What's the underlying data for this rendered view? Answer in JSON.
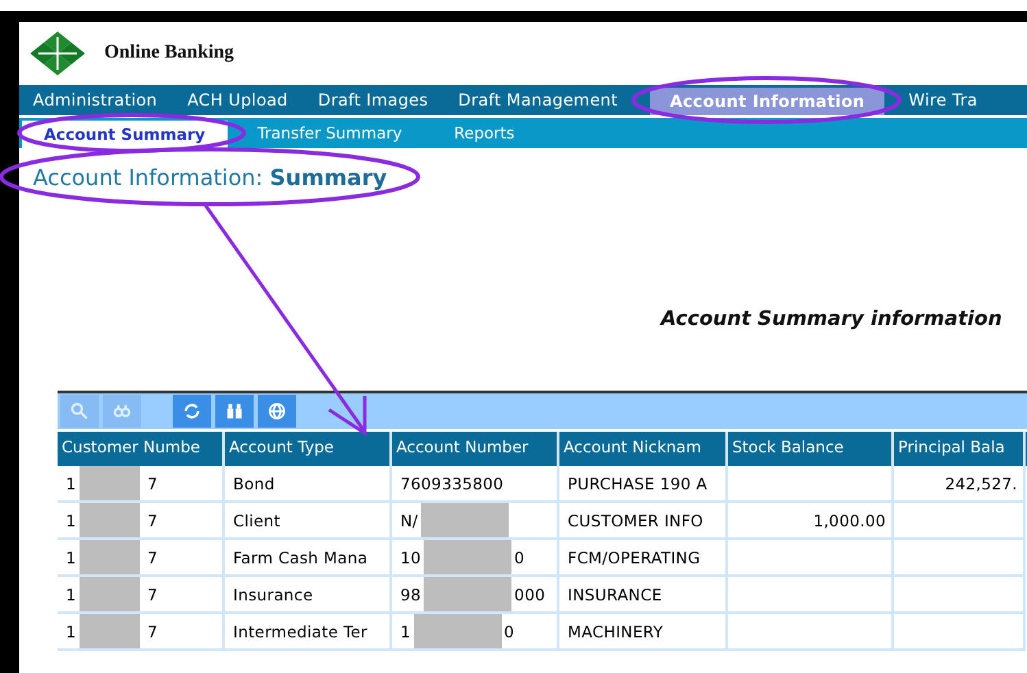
{
  "logo": {
    "title": "Online Banking"
  },
  "nav": [
    {
      "label": "Administration",
      "selected": false
    },
    {
      "label": "ACH Upload",
      "selected": false
    },
    {
      "label": "Draft Images",
      "selected": false
    },
    {
      "label": "Draft Management",
      "selected": false
    },
    {
      "label": "Account Information",
      "selected": true
    },
    {
      "label": "Wire Tra",
      "selected": false
    }
  ],
  "subnav": [
    {
      "label": "Account Summary",
      "selected": true
    },
    {
      "label": "Transfer Summary",
      "selected": false
    },
    {
      "label": "Reports",
      "selected": false
    }
  ],
  "heading": {
    "prefix": "Account Information:",
    "emphasis": "Summary"
  },
  "section_title": "Account Summary information",
  "toolbar": [
    {
      "kind": "search",
      "disabled": true
    },
    {
      "kind": "find",
      "disabled": true
    },
    {
      "kind": "refresh",
      "disabled": false
    },
    {
      "kind": "binoculars",
      "disabled": false
    },
    {
      "kind": "globe",
      "disabled": false
    }
  ],
  "table": {
    "columns": [
      "Customer Numbe",
      "Account Type",
      "Account Number",
      "Account Nicknam",
      "Stock Balance",
      "Principal Bala"
    ],
    "rows": [
      [
        {
          "before": "1",
          "after": "7"
        },
        "Bond",
        "7609335800",
        "PURCHASE 190 A",
        "",
        "242,527."
      ],
      [
        {
          "before": "1",
          "after": "7"
        },
        "Client",
        {
          "before": "N/"
        },
        "CUSTOMER INFO",
        "1,000.00",
        ""
      ],
      [
        {
          "before": "1",
          "after": "7"
        },
        "Farm Cash Mana",
        {
          "before": "10",
          "after": "0"
        },
        "FCM/OPERATING",
        "",
        ""
      ],
      [
        {
          "before": "1",
          "after": "7"
        },
        "Insurance",
        {
          "before": "98",
          "after": "000"
        },
        "INSURANCE",
        "",
        ""
      ],
      [
        {
          "before": "1",
          "after": "7"
        },
        "Intermediate Ter",
        {
          "before": "1",
          "after": "0"
        },
        "MACHINERY",
        "",
        ""
      ]
    ]
  }
}
